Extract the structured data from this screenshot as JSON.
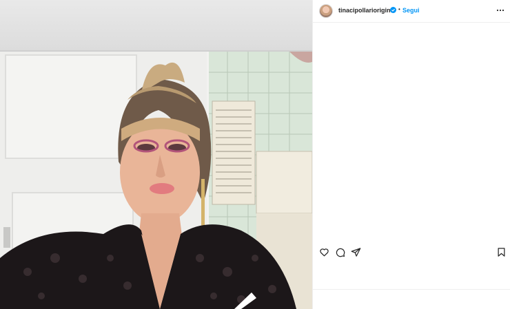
{
  "post": {
    "username": "tinacipollarioriginal",
    "separator": "•",
    "follow_label": "Segui"
  },
  "icons": {
    "verified": "verified-badge-icon",
    "more": "more-options-icon",
    "like": "heart-icon",
    "comment": "comment-icon",
    "share": "paper-plane-icon",
    "save": "bookmark-icon"
  },
  "colors": {
    "accent": "#0095f6",
    "text": "#262626",
    "border": "#efefef"
  }
}
